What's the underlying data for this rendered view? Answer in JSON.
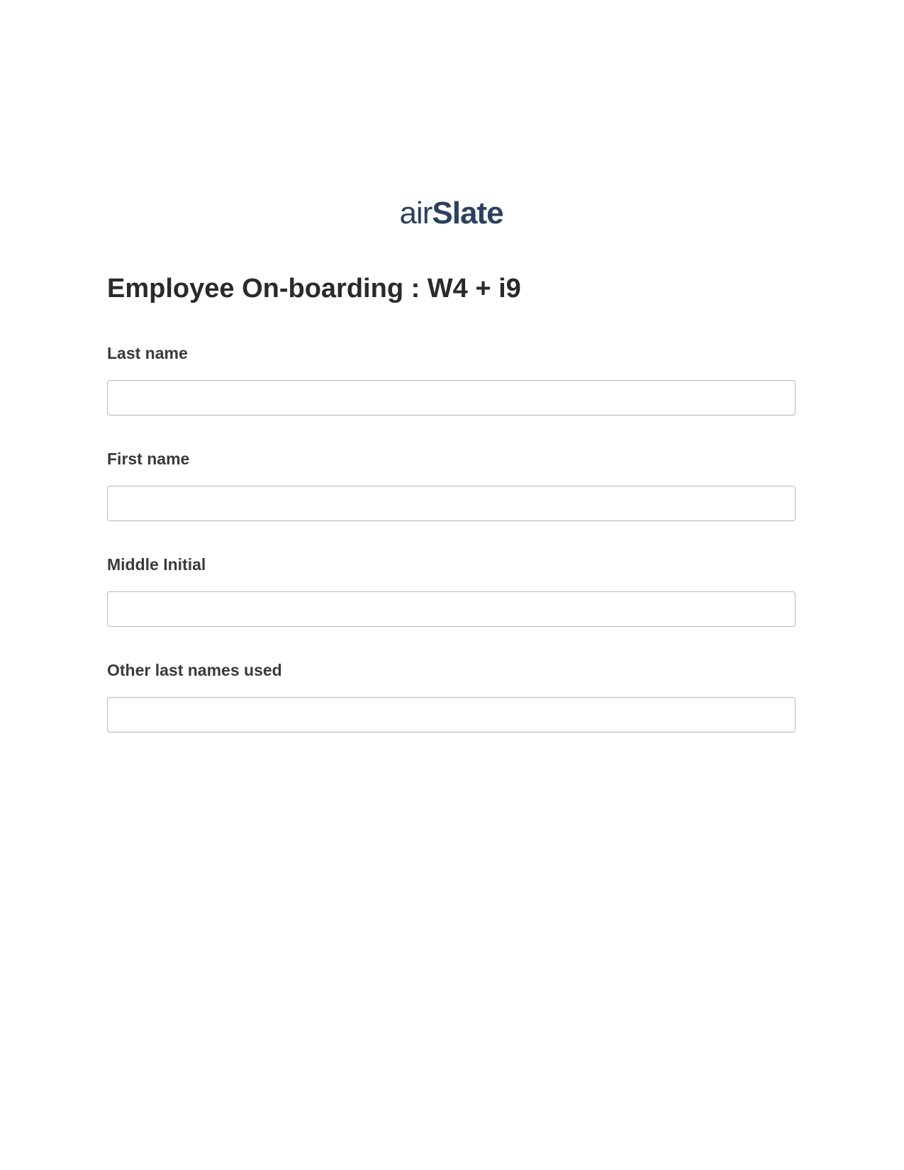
{
  "brand": {
    "name_part1": "air",
    "name_part2": "Slate"
  },
  "form": {
    "title": "Employee On-boarding : W4 + i9",
    "fields": {
      "last_name": {
        "label": "Last name",
        "value": ""
      },
      "first_name": {
        "label": "First name",
        "value": ""
      },
      "middle_initial": {
        "label": "Middle Initial",
        "value": ""
      },
      "other_last_names": {
        "label": "Other last names used",
        "value": ""
      }
    }
  }
}
